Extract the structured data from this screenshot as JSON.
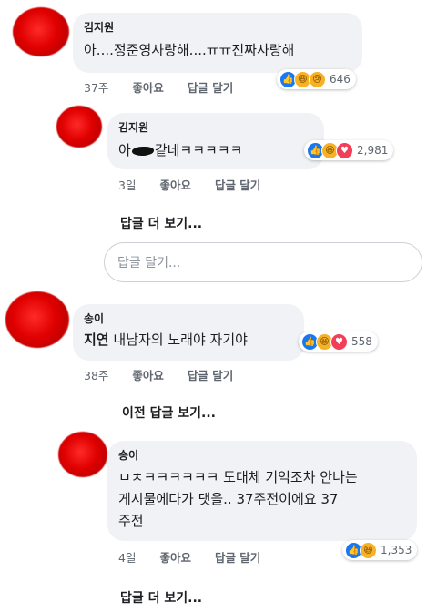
{
  "comments": [
    {
      "author": "김지원",
      "text": "아....정준영사랑해....ㅠㅠ진짜사랑해",
      "time": "37주",
      "like": "좋아요",
      "reply": "답글 달기",
      "reactions": [
        "like",
        "haha",
        "sad"
      ],
      "reaction_count": "646"
    },
    {
      "author": "김지원",
      "text_pre": "아",
      "text_post": "같네ㅋㅋㅋㅋㅋ",
      "time": "3일",
      "like": "좋아요",
      "reply": "답글 달기",
      "reactions": [
        "like",
        "haha",
        "love"
      ],
      "reaction_count": "2,981"
    },
    {
      "author": "송이",
      "tag": "지연",
      "text": "내남자의 노래야 자기야",
      "time": "38주",
      "like": "좋아요",
      "reply": "답글 달기",
      "reactions": [
        "like",
        "haha",
        "love"
      ],
      "reaction_count": "558"
    },
    {
      "author": "송이",
      "text": "ㅁㅊㅋㅋㅋㅋㅋㅋ 도대체 기억조차 안나는\n게시물에다가 댓을.. 37주전이에요 37\n주전",
      "time": "4일",
      "like": "좋아요",
      "reply": "답글 달기",
      "reactions": [
        "like",
        "haha"
      ],
      "reaction_count": "1,353"
    }
  ],
  "links": {
    "more_replies_1": "답글 더 보기...",
    "previous_replies": "이전 답글 보기...",
    "more_replies_2": "답글 더 보기..."
  },
  "reply_input": {
    "placeholder": "답글 달기..."
  },
  "colors": {
    "like": "#1877f2",
    "haha": "#f7b125",
    "love": "#f33e58",
    "bubble": "#f0f2f5"
  }
}
